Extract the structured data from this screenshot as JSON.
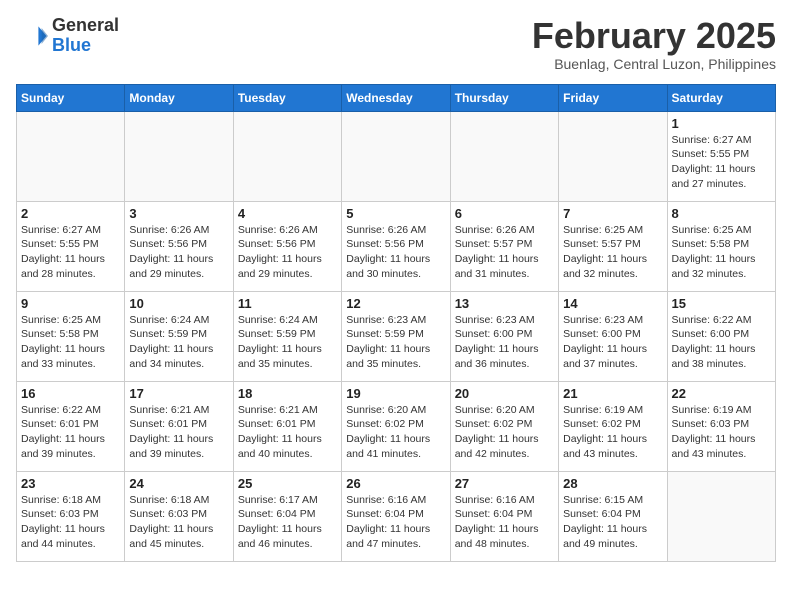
{
  "header": {
    "logo_general": "General",
    "logo_blue": "Blue",
    "month_title": "February 2025",
    "location": "Buenlag, Central Luzon, Philippines"
  },
  "weekdays": [
    "Sunday",
    "Monday",
    "Tuesday",
    "Wednesday",
    "Thursday",
    "Friday",
    "Saturday"
  ],
  "weeks": [
    [
      {
        "day": "",
        "info": ""
      },
      {
        "day": "",
        "info": ""
      },
      {
        "day": "",
        "info": ""
      },
      {
        "day": "",
        "info": ""
      },
      {
        "day": "",
        "info": ""
      },
      {
        "day": "",
        "info": ""
      },
      {
        "day": "1",
        "info": "Sunrise: 6:27 AM\nSunset: 5:55 PM\nDaylight: 11 hours\nand 27 minutes."
      }
    ],
    [
      {
        "day": "2",
        "info": "Sunrise: 6:27 AM\nSunset: 5:55 PM\nDaylight: 11 hours\nand 28 minutes."
      },
      {
        "day": "3",
        "info": "Sunrise: 6:26 AM\nSunset: 5:56 PM\nDaylight: 11 hours\nand 29 minutes."
      },
      {
        "day": "4",
        "info": "Sunrise: 6:26 AM\nSunset: 5:56 PM\nDaylight: 11 hours\nand 29 minutes."
      },
      {
        "day": "5",
        "info": "Sunrise: 6:26 AM\nSunset: 5:56 PM\nDaylight: 11 hours\nand 30 minutes."
      },
      {
        "day": "6",
        "info": "Sunrise: 6:26 AM\nSunset: 5:57 PM\nDaylight: 11 hours\nand 31 minutes."
      },
      {
        "day": "7",
        "info": "Sunrise: 6:25 AM\nSunset: 5:57 PM\nDaylight: 11 hours\nand 32 minutes."
      },
      {
        "day": "8",
        "info": "Sunrise: 6:25 AM\nSunset: 5:58 PM\nDaylight: 11 hours\nand 32 minutes."
      }
    ],
    [
      {
        "day": "9",
        "info": "Sunrise: 6:25 AM\nSunset: 5:58 PM\nDaylight: 11 hours\nand 33 minutes."
      },
      {
        "day": "10",
        "info": "Sunrise: 6:24 AM\nSunset: 5:59 PM\nDaylight: 11 hours\nand 34 minutes."
      },
      {
        "day": "11",
        "info": "Sunrise: 6:24 AM\nSunset: 5:59 PM\nDaylight: 11 hours\nand 35 minutes."
      },
      {
        "day": "12",
        "info": "Sunrise: 6:23 AM\nSunset: 5:59 PM\nDaylight: 11 hours\nand 35 minutes."
      },
      {
        "day": "13",
        "info": "Sunrise: 6:23 AM\nSunset: 6:00 PM\nDaylight: 11 hours\nand 36 minutes."
      },
      {
        "day": "14",
        "info": "Sunrise: 6:23 AM\nSunset: 6:00 PM\nDaylight: 11 hours\nand 37 minutes."
      },
      {
        "day": "15",
        "info": "Sunrise: 6:22 AM\nSunset: 6:00 PM\nDaylight: 11 hours\nand 38 minutes."
      }
    ],
    [
      {
        "day": "16",
        "info": "Sunrise: 6:22 AM\nSunset: 6:01 PM\nDaylight: 11 hours\nand 39 minutes."
      },
      {
        "day": "17",
        "info": "Sunrise: 6:21 AM\nSunset: 6:01 PM\nDaylight: 11 hours\nand 39 minutes."
      },
      {
        "day": "18",
        "info": "Sunrise: 6:21 AM\nSunset: 6:01 PM\nDaylight: 11 hours\nand 40 minutes."
      },
      {
        "day": "19",
        "info": "Sunrise: 6:20 AM\nSunset: 6:02 PM\nDaylight: 11 hours\nand 41 minutes."
      },
      {
        "day": "20",
        "info": "Sunrise: 6:20 AM\nSunset: 6:02 PM\nDaylight: 11 hours\nand 42 minutes."
      },
      {
        "day": "21",
        "info": "Sunrise: 6:19 AM\nSunset: 6:02 PM\nDaylight: 11 hours\nand 43 minutes."
      },
      {
        "day": "22",
        "info": "Sunrise: 6:19 AM\nSunset: 6:03 PM\nDaylight: 11 hours\nand 43 minutes."
      }
    ],
    [
      {
        "day": "23",
        "info": "Sunrise: 6:18 AM\nSunset: 6:03 PM\nDaylight: 11 hours\nand 44 minutes."
      },
      {
        "day": "24",
        "info": "Sunrise: 6:18 AM\nSunset: 6:03 PM\nDaylight: 11 hours\nand 45 minutes."
      },
      {
        "day": "25",
        "info": "Sunrise: 6:17 AM\nSunset: 6:04 PM\nDaylight: 11 hours\nand 46 minutes."
      },
      {
        "day": "26",
        "info": "Sunrise: 6:16 AM\nSunset: 6:04 PM\nDaylight: 11 hours\nand 47 minutes."
      },
      {
        "day": "27",
        "info": "Sunrise: 6:16 AM\nSunset: 6:04 PM\nDaylight: 11 hours\nand 48 minutes."
      },
      {
        "day": "28",
        "info": "Sunrise: 6:15 AM\nSunset: 6:04 PM\nDaylight: 11 hours\nand 49 minutes."
      },
      {
        "day": "",
        "info": ""
      }
    ]
  ]
}
